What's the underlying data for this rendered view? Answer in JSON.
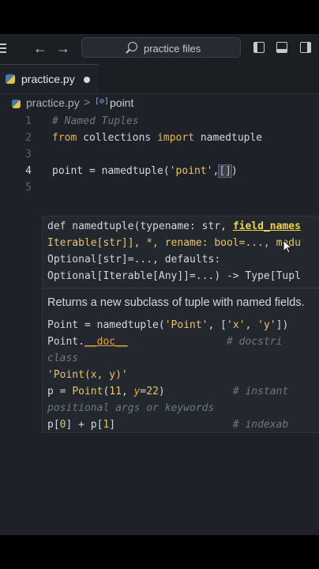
{
  "titlebar": {
    "search_placeholder": "practice files",
    "icons": [
      "menu-icon",
      "back-arrow-icon",
      "forward-arrow-icon",
      "search-icon",
      "toggle-sidebar-icon",
      "toggle-panel-icon",
      "toggle-secondary-sidebar-icon"
    ]
  },
  "tabs": [
    {
      "label": "practice.py",
      "modified": true
    }
  ],
  "breadcrumb": {
    "file": "practice.py",
    "separator": ">",
    "symbol_icon": "[⊘]",
    "symbol": "point"
  },
  "editor": {
    "line_numbers": [
      "1",
      "2",
      "3",
      "4",
      "5"
    ],
    "active_line": "4",
    "lines": {
      "l1": "# Named Tuples",
      "l2_kw1": "from",
      "l2_mid": " collections ",
      "l2_kw2": "import",
      "l2_end": " namedtuple",
      "l4_pre": "point = namedtuple(",
      "l4_str": "'point'",
      "l4_comma": ",",
      "l4_brk": "[]",
      "l4_close": ")"
    }
  },
  "hover": {
    "sig1_a": "def namedtuple(typename: str, ",
    "sig1_param": "field_names",
    "sig2_a": "Iterable[str]], *, rename: bool=..., modu",
    "sig3_a": "Optional[str]=..., defaults:",
    "sig4_a": "Optional[Iterable[Any]]=...) -> Type[Tupl",
    "doc": "Returns a new subclass of tuple with named fields.",
    "ex1_a": "Point = namedtuple(",
    "ex1_s1": "'Point'",
    "ex1_b": ", [",
    "ex1_s2": "'x'",
    "ex1_c": ", ",
    "ex1_s3": "'y'",
    "ex1_d": "])",
    "ex2_a": "Point.",
    "ex2_doc": "__doc__",
    "ex2_cm": "# docstri",
    "ex3": "class",
    "ex4": "'Point(x, y)'",
    "ex5_a": "p = ",
    "ex5_cls": "Point",
    "ex5_b": "(",
    "ex5_n1": "11",
    "ex5_c": ", ",
    "ex5_kw": "y",
    "ex5_d": "=",
    "ex5_n2": "22",
    "ex5_e": ")",
    "ex5_cm": "# instant",
    "ex6": "positional args or keywords",
    "ex7_a": "p[",
    "ex7_n1": "0",
    "ex7_b": "] + p[",
    "ex7_n2": "1",
    "ex7_c": "]",
    "ex7_cm": "# indexab"
  }
}
